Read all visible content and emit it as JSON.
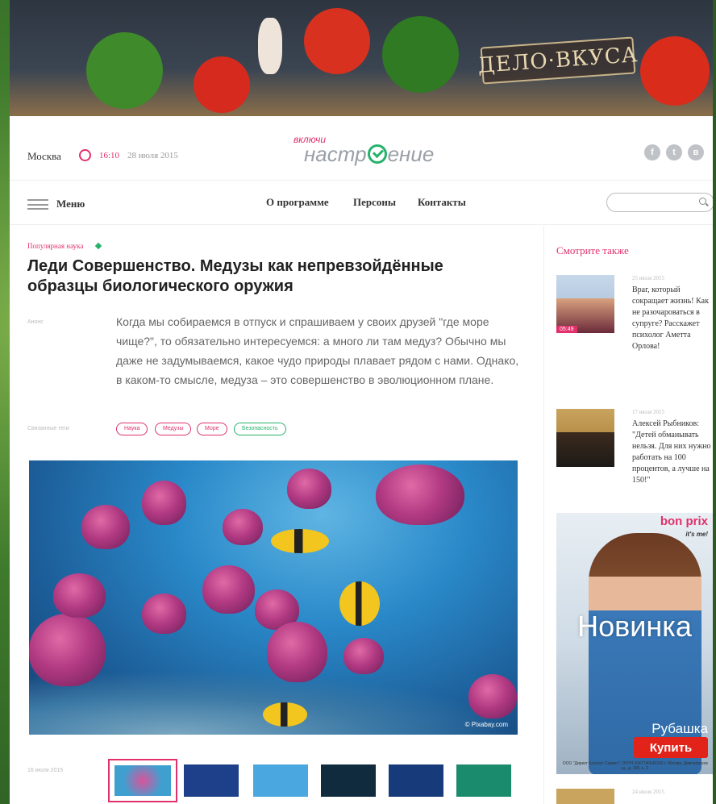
{
  "banner": {
    "sign": "ДЕЛО·ВКУСА"
  },
  "header": {
    "city": "Москва",
    "time": "16:10",
    "date": "28 июля 2015",
    "brand_small": "включи",
    "brand_part1": "настр",
    "brand_part2": "ение",
    "social": [
      "f",
      "t",
      "в"
    ]
  },
  "nav": {
    "menu": "Меню",
    "links": [
      "О программе",
      "Персоны",
      "Контакты"
    ],
    "search_placeholder": ""
  },
  "article": {
    "category": "Популярная наука",
    "title": "Леди Совершенство. Медузы как непревзойдённые образцы биологического оружия",
    "lead_label": "Анонс",
    "lead": "Когда мы собираемся в отпуск и спрашиваем у своих друзей \"где море чище?\", то обязательно интересуемся: а много ли там медуз? Обычно мы даже не задумываемся, какое чудо природы плавает рядом с нами. Однако, в каком-то смысле, медуза – это совершенство в эволюционном плане.",
    "tags_label": "Связанные теги",
    "tags": [
      "Наука",
      "Медузы",
      "Море",
      "Безопасность"
    ],
    "photo_credit": "© Pixabay.com",
    "gallery_date": "16 июля 2015",
    "thumb_colors": [
      "#3fa0d0",
      "#1e3f8a",
      "#4aa7e0",
      "#0f2b3d",
      "#173a7a",
      "#1b8b6e"
    ]
  },
  "sidebar": {
    "title": "Смотрите также",
    "items": [
      {
        "date": "25 июля 2015",
        "text": "Враг, который сокращает жизнь! Как не разочароваться в супруге? Расскажет психолог Аметта Орлова!",
        "badge": "05:49"
      },
      {
        "date": "17 июля 2015",
        "text": "Алексей Рыбников: \"Детей обманывать нельзя. Для них нужно работать на 100 процентов, а лучше на 150!\""
      }
    ],
    "third_date": "24 июля 2015"
  },
  "ad": {
    "logo": "bon prix",
    "logo_tag": "it's me!",
    "headline": "Новинка",
    "sub": "Рубашка",
    "button": "Купить",
    "fine": "ООО \"Директ Каталог Сервис\", ОГРН 1047746540200 г. Москва, Дмитровское ш., д. 100, к. 2."
  }
}
